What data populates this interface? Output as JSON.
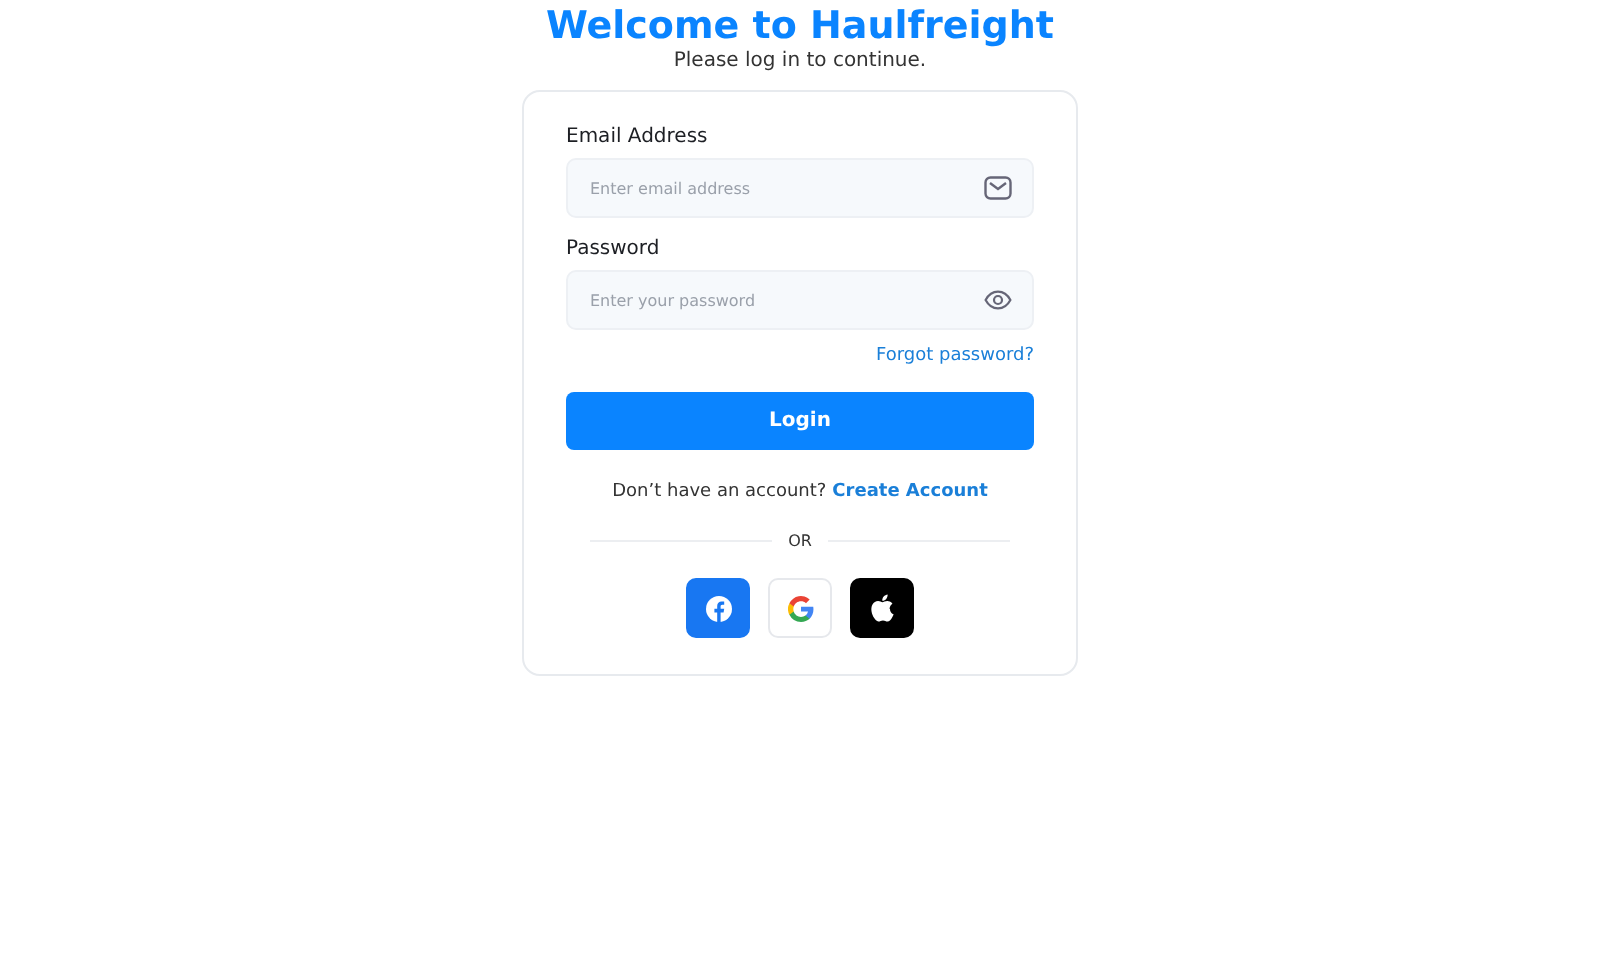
{
  "header": {
    "title": "Welcome to Haulfreight",
    "subtitle": "Please log in to continue."
  },
  "form": {
    "fields": [
      {
        "kind": "email",
        "label": "Email Address",
        "placeholder": "Enter email address"
      },
      {
        "kind": "password",
        "label": "Password",
        "placeholder": "Enter your password"
      }
    ],
    "forgot_link": "Forgot password?",
    "login_button": "Login",
    "signup_prompt": "Don’t have an account?",
    "signup_link": "Create Account",
    "divider": "OR",
    "social_buttons": [
      {
        "kind": "facebook"
      },
      {
        "kind": "google"
      },
      {
        "kind": "apple"
      }
    ]
  }
}
